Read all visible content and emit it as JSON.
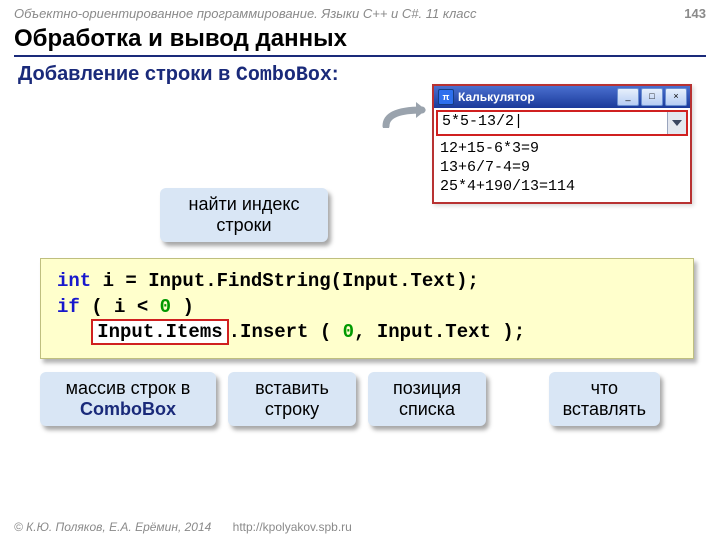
{
  "header": {
    "course": "Объектно-ориентированное программирование. Языки C++ и C#. 11 класс",
    "page": "143"
  },
  "title": "Обработка и вывод данных",
  "subtitle_prefix": "Добавление строки в ",
  "subtitle_mono": "ComboBox",
  "subtitle_suffix": ":",
  "window": {
    "title": "Калькулятор",
    "btn_min": "_",
    "btn_max": "□",
    "btn_close": "×",
    "input": "5*5-13/2",
    "caret": "|",
    "history": [
      "12+15-6*3=9",
      "13+6/7-4=9",
      "25*4+190/13=114"
    ]
  },
  "callout_top": "найти индекс\nстроки",
  "code": {
    "l1_a": "int",
    "l1_b": " i = Input.FindString(Input.Text);",
    "l2_a": "if",
    "l2_b": " ( i < ",
    "l2_c": "0",
    "l2_d": " )",
    "l3_pad": "   ",
    "l3_patch": "Input.Items",
    "l3_a": ".Insert ( ",
    "l3_b": "0",
    "l3_c": ", Input.Text );"
  },
  "callouts_bottom": [
    {
      "line1": "массив строк в",
      "emph": "ComboBox"
    },
    {
      "line1": "вставить",
      "line2": "строку"
    },
    {
      "line1": "позиция",
      "line2": "списка"
    },
    {
      "line1": "что",
      "line2": "вставлять"
    }
  ],
  "footer": {
    "copy": "© К.Ю. Поляков, Е.А. Ерёмин, 2014",
    "url": "http://kpolyakov.spb.ru"
  }
}
